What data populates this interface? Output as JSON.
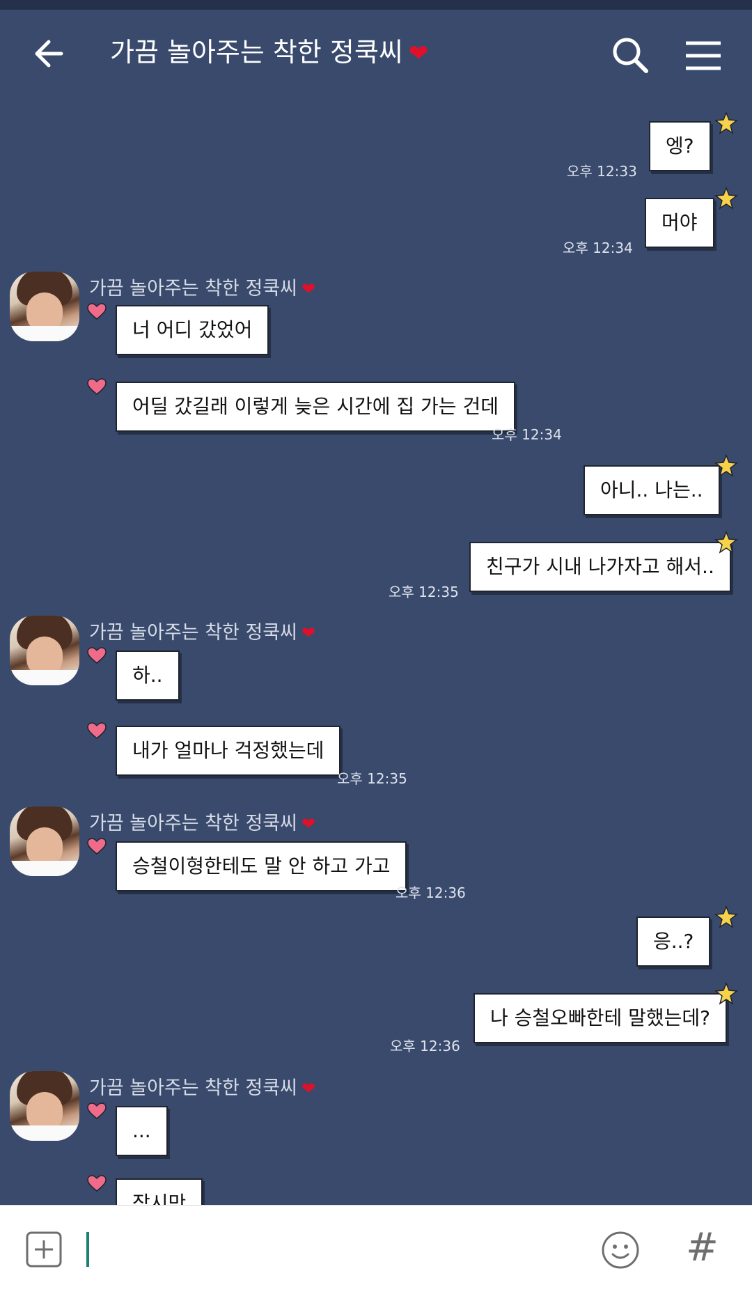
{
  "header": {
    "title": "가끔 놀아주는 착한 정쿡씨",
    "title_heart": "❤"
  },
  "sender_name": "가끔 놀아주는 착한 정쿡씨",
  "sender_heart": "❤",
  "messages": [
    {
      "text": "엥?",
      "time": "오후 12:33"
    },
    {
      "text": "머야",
      "time": "오후 12:34"
    },
    {
      "text": "너 어디 갔었어"
    },
    {
      "text": "어딜 갔길래 이렇게 늦은 시간에 집 가는 건데",
      "time": "오후 12:34"
    },
    {
      "text": "아니.. 나는.."
    },
    {
      "text": "친구가 시내 나가자고 해서..",
      "time": "오후 12:35"
    },
    {
      "text": "하.."
    },
    {
      "text": "내가 얼마나 걱정했는데",
      "time": "오후 12:35"
    },
    {
      "text": "승철이형한테도 말 안 하고 가고",
      "time": "오후 12:36"
    },
    {
      "text": "응..?"
    },
    {
      "text": "나 승철오빠한테 말했는데?",
      "time": "오후 12:36"
    },
    {
      "text": "..."
    },
    {
      "text": "잠시만"
    }
  ],
  "input": {
    "value": ""
  },
  "icons": {
    "back": "back-arrow-icon",
    "search": "search-icon",
    "menu": "menu-icon",
    "plus": "plus-square-icon",
    "emoji": "emoji-icon",
    "hash": "#"
  },
  "colors": {
    "background": "#394a6d",
    "accent": "#1a7f76",
    "heart": "#e0102b",
    "star": "#f7d24a"
  }
}
